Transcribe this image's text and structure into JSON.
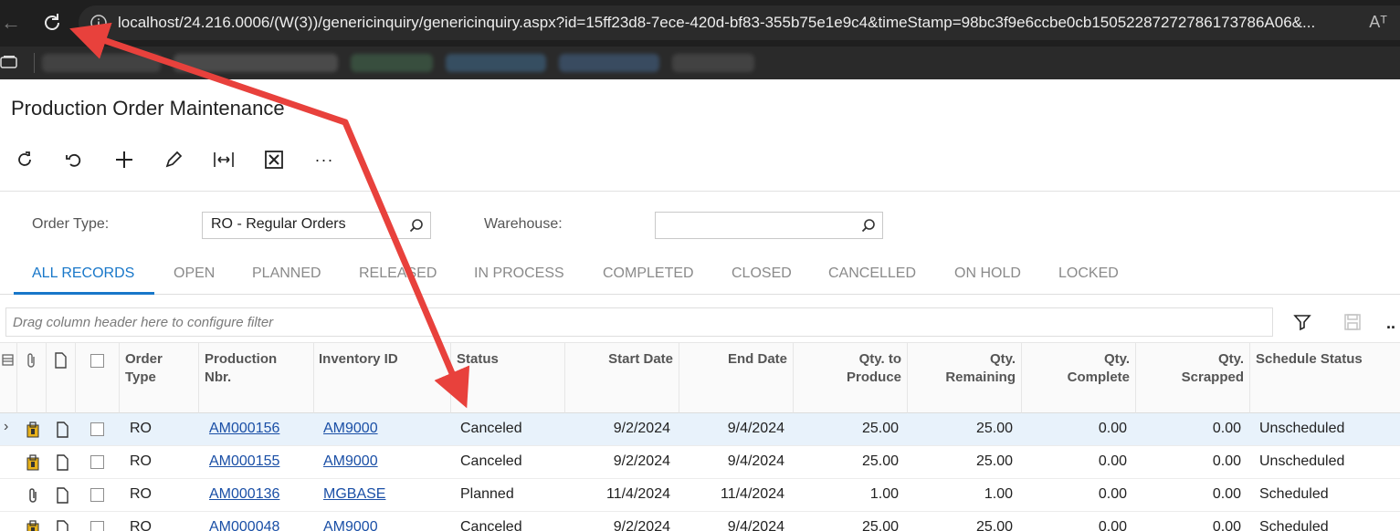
{
  "browser": {
    "url": "localhost/24.216.0006/(W(3))/genericinquiry/genericinquiry.aspx?id=15ff23d8-7ece-420d-bf83-355b75e1e9c4&timeStamp=98bc3f9e6ccbe0cb1505228727278617378​6A06&...",
    "read_aloud": "Aᵀ"
  },
  "page": {
    "title": "Production Order Maintenance"
  },
  "toolbar": {
    "icons": [
      "refresh-icon",
      "undo-icon",
      "add-icon",
      "edit-icon",
      "fit-columns-icon",
      "excel-export-icon",
      "more-icon"
    ],
    "more_label": "···"
  },
  "filters": {
    "order_type_label": "Order Type:",
    "order_type_value": "RO - Regular Orders",
    "warehouse_label": "Warehouse:",
    "warehouse_value": ""
  },
  "tabs": [
    "ALL RECORDS",
    "OPEN",
    "PLANNED",
    "RELEASED",
    "IN PROCESS",
    "COMPLETED",
    "CLOSED",
    "CANCELLED",
    "ON HOLD",
    "LOCKED"
  ],
  "active_tab": "ALL RECORDS",
  "grid": {
    "filter_placeholder": "Drag column header here to configure filter",
    "more_label": "..",
    "columns": {
      "order_type": [
        "Order",
        "Type"
      ],
      "production_nbr": [
        "Production",
        "Nbr."
      ],
      "inventory_id": "Inventory ID",
      "status": "Status",
      "start_date": "Start Date",
      "end_date": "End Date",
      "qty_to_produce": [
        "Qty. to",
        "Produce"
      ],
      "qty_remaining": [
        "Qty.",
        "Remaining"
      ],
      "qty_complete": [
        "Qty.",
        "Complete"
      ],
      "qty_scrapped": [
        "Qty.",
        "Scrapped"
      ],
      "schedule_status": "Schedule Status"
    },
    "rows": [
      {
        "order_type": "RO",
        "production_nbr": "AM000156",
        "inventory_id": "AM9000",
        "status": "Canceled",
        "start_date": "9/2/2024",
        "end_date": "9/4/2024",
        "qty_to_produce": "25.00",
        "qty_remaining": "25.00",
        "qty_complete": "0.00",
        "qty_scrapped": "0.00",
        "schedule_status": "Unscheduled",
        "attachment": "note-yellow",
        "selected": true
      },
      {
        "order_type": "RO",
        "production_nbr": "AM000155",
        "inventory_id": "AM9000",
        "status": "Canceled",
        "start_date": "9/2/2024",
        "end_date": "9/4/2024",
        "qty_to_produce": "25.00",
        "qty_remaining": "25.00",
        "qty_complete": "0.00",
        "qty_scrapped": "0.00",
        "schedule_status": "Unscheduled",
        "attachment": "note-yellow",
        "selected": false
      },
      {
        "order_type": "RO",
        "production_nbr": "AM000136",
        "inventory_id": "MGBASE",
        "status": "Planned",
        "start_date": "11/4/2024",
        "end_date": "11/4/2024",
        "qty_to_produce": "1.00",
        "qty_remaining": "1.00",
        "qty_complete": "0.00",
        "qty_scrapped": "0.00",
        "schedule_status": "Scheduled",
        "attachment": "paperclip",
        "selected": false
      },
      {
        "order_type": "RO",
        "production_nbr": "AM000048",
        "inventory_id": "AM9000",
        "status": "Canceled",
        "start_date": "9/2/2024",
        "end_date": "9/4/2024",
        "qty_to_produce": "25.00",
        "qty_remaining": "25.00",
        "qty_complete": "0.00",
        "qty_scrapped": "0.00",
        "schedule_status": "Scheduled",
        "attachment": "note-yellow",
        "selected": false
      }
    ]
  },
  "colors": {
    "accent": "#1877c9",
    "annotation_arrow": "#e8413c",
    "link": "#1a4fa6"
  }
}
